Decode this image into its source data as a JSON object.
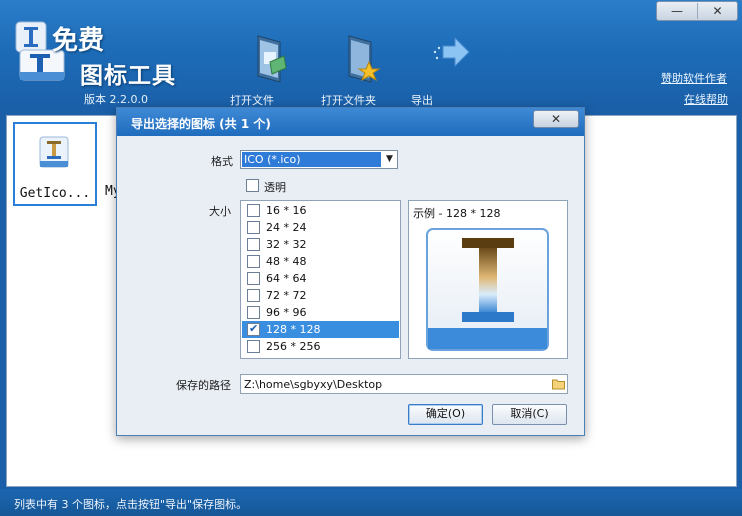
{
  "app": {
    "logo_top": "免费",
    "logo_main": "图标工具",
    "version": "版本 2.2.0.0",
    "window_controls": {
      "minimize": "—",
      "close": "✕"
    },
    "toolbar": {
      "open_file": "打开文件",
      "open_folder": "打开文件夹",
      "export": "导出"
    },
    "links": {
      "donate": "赞助软件作者",
      "help": "在线帮助"
    },
    "items": [
      {
        "name": "GetIco..."
      },
      {
        "name": "My"
      }
    ],
    "status": "列表中有 3 个图标，点击按钮\"导出\"保存图标。"
  },
  "dialog": {
    "title": "导出选择的图标 (共 1 个)",
    "close": "✕",
    "format_label": "格式",
    "format_value": "ICO (*.ico)",
    "transparent_label": "透明",
    "transparent_checked": false,
    "size_label": "大小",
    "sizes": [
      {
        "label": "16 * 16",
        "checked": false
      },
      {
        "label": "24 * 24",
        "checked": false
      },
      {
        "label": "32 * 32",
        "checked": false
      },
      {
        "label": "48 * 48",
        "checked": false
      },
      {
        "label": "64 * 64",
        "checked": false
      },
      {
        "label": "72 * 72",
        "checked": false
      },
      {
        "label": "96 * 96",
        "checked": false
      },
      {
        "label": "128 * 128",
        "checked": true,
        "selected": true
      },
      {
        "label": "256 * 256",
        "checked": false
      }
    ],
    "preview_title": "示例 - 128 * 128",
    "path_label": "保存的路径",
    "path_value": "Z:\\home\\sgbyxy\\Desktop",
    "ok": "确定(O)",
    "cancel": "取消(C)"
  },
  "colors": {
    "accent": "#1d6cb8",
    "selection": "#3a8ee0",
    "dialog_bg": "#e9eef5"
  }
}
